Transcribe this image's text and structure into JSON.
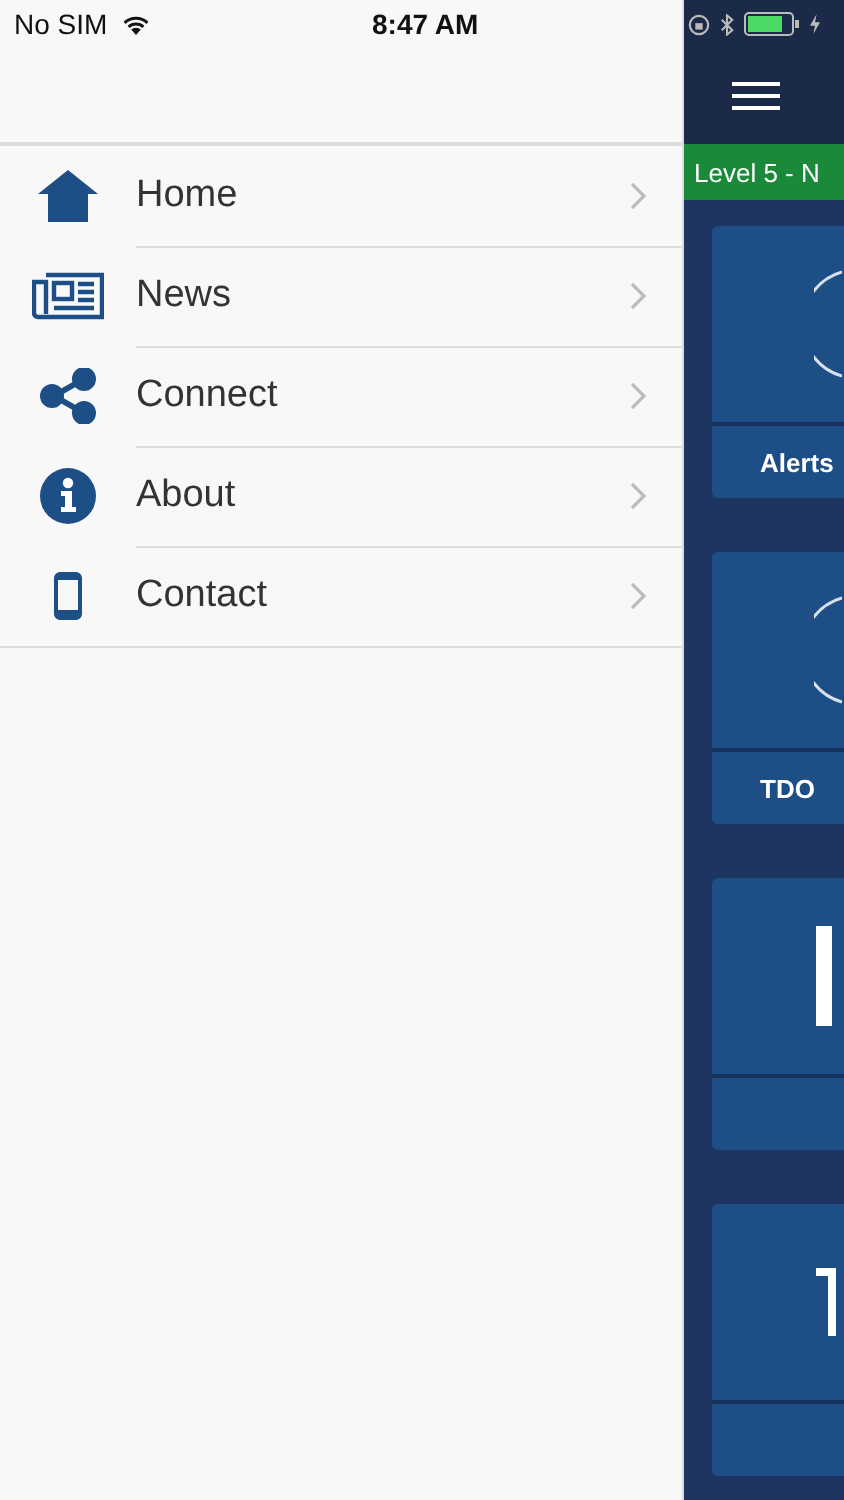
{
  "status_bar": {
    "carrier": "No SIM",
    "time": "8:47 AM"
  },
  "menu": [
    {
      "label": "Home",
      "kind": "home"
    },
    {
      "label": "News",
      "kind": "news"
    },
    {
      "label": "Connect",
      "kind": "share"
    },
    {
      "label": "About",
      "kind": "info"
    },
    {
      "label": "Contact",
      "kind": "phone"
    }
  ],
  "background_app": {
    "banner": "Level 5 - N",
    "tiles": [
      {
        "label": "Alerts",
        "kind": "ring"
      },
      {
        "label": "TDO",
        "kind": "ring"
      },
      {
        "kind": "bar"
      },
      {
        "kind": "tee"
      }
    ]
  }
}
